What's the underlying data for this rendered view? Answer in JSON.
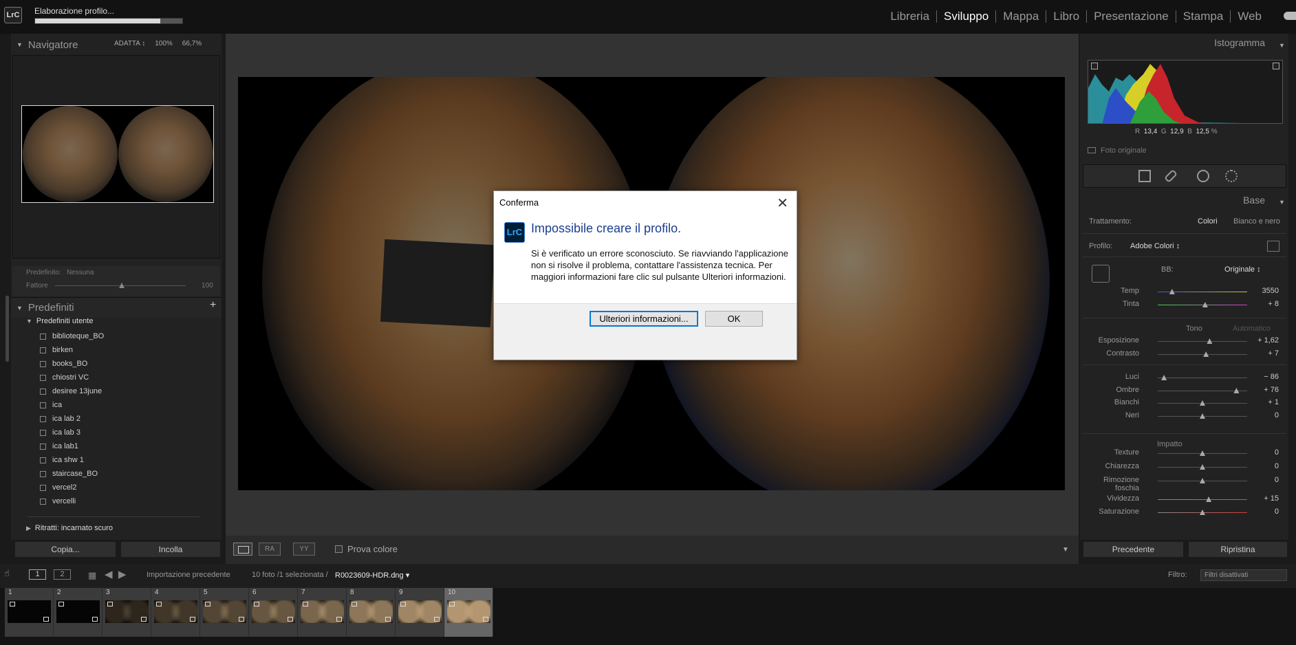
{
  "app": {
    "logo": "LrC",
    "progress_title": "Elaborazione profilo...",
    "progress_fraction": 0.85
  },
  "modules": [
    "Libreria",
    "Sviluppo",
    "Mappa",
    "Libro",
    "Presentazione",
    "Stampa",
    "Web"
  ],
  "active_module": "Sviluppo",
  "navigator": {
    "title": "Navigatore",
    "fit": "ADATTA ↕",
    "zoom1": "100%",
    "zoom2": "66,7%"
  },
  "preset_info": {
    "predefinito_label": "Predefinito:",
    "predefinito_value": "Nessuna",
    "fattore_label": "Fattore",
    "fattore_value": "100",
    "fattore_fraction": 0.5
  },
  "presets": {
    "title": "Predefiniti",
    "group": "Predefiniti utente",
    "items": [
      "biblioteque_BO",
      "birken",
      "books_BO",
      "chiostri VC",
      "desiree 13june",
      "ica",
      "ica lab 2",
      "ica lab 3",
      "ica lab1",
      "ica shw 1",
      "staircase_BO",
      "vercel2",
      "vercelli"
    ],
    "next_group": "Ritratti: incarnato scuro"
  },
  "left_buttons": {
    "copy": "Copia...",
    "paste": "Incolla"
  },
  "toolbar": {
    "vb_a": "RA",
    "vb_b": "YY",
    "prova_colore": "Prova colore"
  },
  "histogram": {
    "title": "Istogramma",
    "r_label": "R",
    "r": "13,4",
    "g_label": "G",
    "g": "12,9",
    "b_label": "B",
    "b": "12,5",
    "pct": "%",
    "foto_originale": "Foto originale"
  },
  "base": {
    "title": "Base",
    "trattamento_label": "Trattamento:",
    "trattamento_colori": "Colori",
    "trattamento_bn": "Bianco e nero",
    "profilo_label": "Profilo:",
    "profilo_value": "Adobe Colori ↕",
    "bb_label": "BB:",
    "bb_value": "Originale ↕",
    "tono_label": "Tono",
    "automatico_label": "Automatico",
    "impatto_label": "Impatto",
    "sliders": [
      {
        "label": "Temp",
        "value": "3550",
        "pos": 0.16
      },
      {
        "label": "Tinta",
        "value": "+ 8",
        "pos": 0.53
      },
      {
        "label": "Esposizione",
        "value": "+ 1,62",
        "pos": 0.58
      },
      {
        "label": "Contrasto",
        "value": "+ 7",
        "pos": 0.54
      },
      {
        "label": "Luci",
        "value": "− 86",
        "pos": 0.07
      },
      {
        "label": "Ombre",
        "value": "+ 76",
        "pos": 0.88
      },
      {
        "label": "Bianchi",
        "value": "+ 1",
        "pos": 0.5
      },
      {
        "label": "Neri",
        "value": "0",
        "pos": 0.5
      },
      {
        "label": "Texture",
        "value": "0",
        "pos": 0.5
      },
      {
        "label": "Chiarezza",
        "value": "0",
        "pos": 0.5
      },
      {
        "label": "Rimozione foschia",
        "value": "0",
        "pos": 0.5
      },
      {
        "label": "Vividezza",
        "value": "+ 15",
        "pos": 0.57
      },
      {
        "label": "Saturazione",
        "value": "0",
        "pos": 0.5
      }
    ]
  },
  "right_buttons": {
    "previous": "Precedente",
    "reset": "Ripristina"
  },
  "filmstrip": {
    "page1": "1",
    "page2": "2",
    "import": "Importazione precedente",
    "count": "10 foto /1 selezionata /",
    "filename": "R0023609-HDR.dng ▾",
    "filtro_label": "Filtro:",
    "filtro_value": "Filtri disattivati",
    "cells": [
      "1",
      "2",
      "3",
      "4",
      "5",
      "6",
      "7",
      "8",
      "9",
      "10"
    ],
    "selected": "10"
  },
  "dialog": {
    "title": "Conferma",
    "icon": "LrC",
    "heading": "Impossibile creare il profilo.",
    "message": "Si è verificato un errore sconosciuto.  Se riavviando l'applicazione non si risolve il problema, contattare l'assistenza tecnica. Per maggiori informazioni fare clic sul pulsante Ulteriori informazioni.",
    "more_button": "Ulteriori informazioni...",
    "ok_button": "OK"
  }
}
